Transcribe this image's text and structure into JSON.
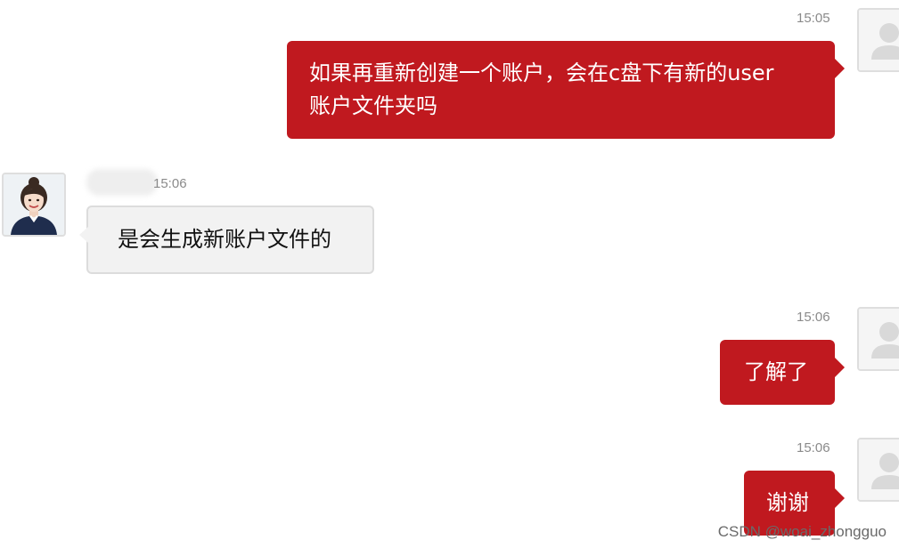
{
  "messages": [
    {
      "side": "outgoing",
      "time": "15:05",
      "text_line1": "如果再重新创建一个账户，会在c盘下有新的user",
      "text_line2": "账户文件夹吗"
    },
    {
      "side": "incoming",
      "time": "15:06",
      "text": "是会生成新账户文件的"
    },
    {
      "side": "outgoing",
      "time": "15:06",
      "text": "了解了"
    },
    {
      "side": "outgoing",
      "time": "15:06",
      "text": "谢谢"
    }
  ],
  "watermark": "CSDN @woai_zhongguo",
  "icons": {
    "user_avatar": "default-user-placeholder-icon",
    "agent_avatar": "agent-portrait"
  },
  "colors": {
    "outgoing_bubble": "#c0191f",
    "incoming_bubble": "#f2f2f2",
    "timestamp": "#8a8a8a"
  }
}
